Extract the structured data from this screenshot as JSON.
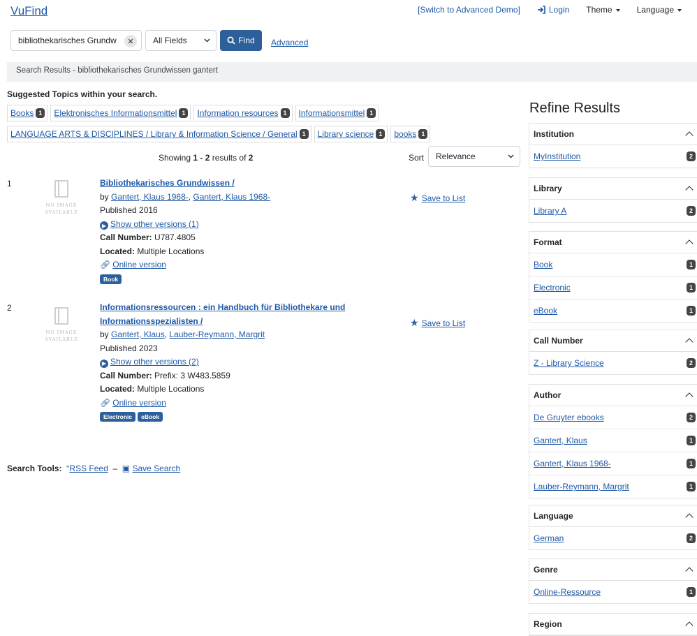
{
  "header": {
    "logo": "VuFind",
    "demo_link": "[Switch to Advanced Demo]",
    "login": "Login",
    "theme": "Theme",
    "language": "Language"
  },
  "search": {
    "query": "bibliothekarisches Grundw",
    "type": "All Fields",
    "find_label": "Find",
    "advanced_label": "Advanced"
  },
  "breadcrumb": "Search Results - bibliothekarisches Grundwissen gantert",
  "topics": {
    "title": "Suggested Topics within your search.",
    "row1": [
      {
        "label": "Books",
        "count": "1"
      },
      {
        "label": "Elektronisches Informationsmittel",
        "count": "1"
      },
      {
        "label": "Information resources",
        "count": "1"
      },
      {
        "label": "Informationsmittel",
        "count": "1"
      }
    ],
    "row2": [
      {
        "label": "LANGUAGE ARTS & DISCIPLINES / Library & Information Science / General",
        "count": "1"
      },
      {
        "label": "Library science",
        "count": "1"
      },
      {
        "label": "books",
        "count": "1"
      }
    ]
  },
  "results_header": {
    "showing_prefix": "Showing ",
    "range": "1 - 2",
    "results_of": " results of ",
    "total": "2",
    "sort_label": "Sort",
    "sort_value": "Relevance"
  },
  "no_image": [
    "NO IMAGE",
    "AVAILABLE"
  ],
  "results": [
    {
      "num": "1",
      "title": "Bibliothekarisches Grundwissen /",
      "by": "by ",
      "authors": [
        "Gantert, Klaus 1968-",
        "Gantert, Klaus 1968-"
      ],
      "published": "Published 2016",
      "versions": "Show other versions (1)",
      "call_label": "Call Number:",
      "call_value": " U787.4805",
      "located_label": "Located:",
      "located_value": " Multiple Locations",
      "online": "Online version",
      "formats": [
        "Book"
      ],
      "save": "Save to List"
    },
    {
      "num": "2",
      "title_line1": "Informationsressourcen : ein Handbuch für Bibliothekare und",
      "title_line2": "Informationsspezialisten /",
      "by": "by ",
      "authors": [
        "Gantert, Klaus",
        "Lauber-Reymann, Margrit"
      ],
      "published": "Published 2023",
      "versions": "Show other versions (2)",
      "call_label": "Call Number:",
      "call_value": " Prefix: 3 W483.5859",
      "located_label": "Located:",
      "located_value": " Multiple Locations",
      "online": "Online version",
      "formats": [
        "Electronic",
        "eBook"
      ],
      "save": "Save to List"
    }
  ],
  "tools": {
    "label": "Search Tools:",
    "rss": "RSS Feed",
    "sep": "–",
    "save_search": "Save Search"
  },
  "sidebar": {
    "title": "Refine Results",
    "facets": [
      {
        "name": "Institution",
        "items": [
          {
            "label": "MyInstitution",
            "count": "2"
          }
        ]
      },
      {
        "name": "Library",
        "items": [
          {
            "label": "Library A",
            "count": "2"
          }
        ]
      },
      {
        "name": "Format",
        "items": [
          {
            "label": "Book",
            "count": "1"
          },
          {
            "label": "Electronic",
            "count": "1"
          },
          {
            "label": "eBook",
            "count": "1"
          }
        ]
      },
      {
        "name": "Call Number",
        "items": [
          {
            "label": "Z - Library Science",
            "count": "2"
          }
        ]
      },
      {
        "name": "Author",
        "items": [
          {
            "label": "De Gruyter ebooks",
            "count": "2"
          },
          {
            "label": "Gantert, Klaus",
            "count": "1"
          },
          {
            "label": "Gantert, Klaus 1968-",
            "count": "1"
          },
          {
            "label": "Lauber-Reymann, Margrit",
            "count": "1"
          }
        ]
      },
      {
        "name": "Language",
        "items": [
          {
            "label": "German",
            "count": "2"
          }
        ]
      },
      {
        "name": "Genre",
        "items": [
          {
            "label": "Online-Ressource",
            "count": "1"
          }
        ]
      },
      {
        "name": "Region",
        "items": []
      }
    ]
  }
}
